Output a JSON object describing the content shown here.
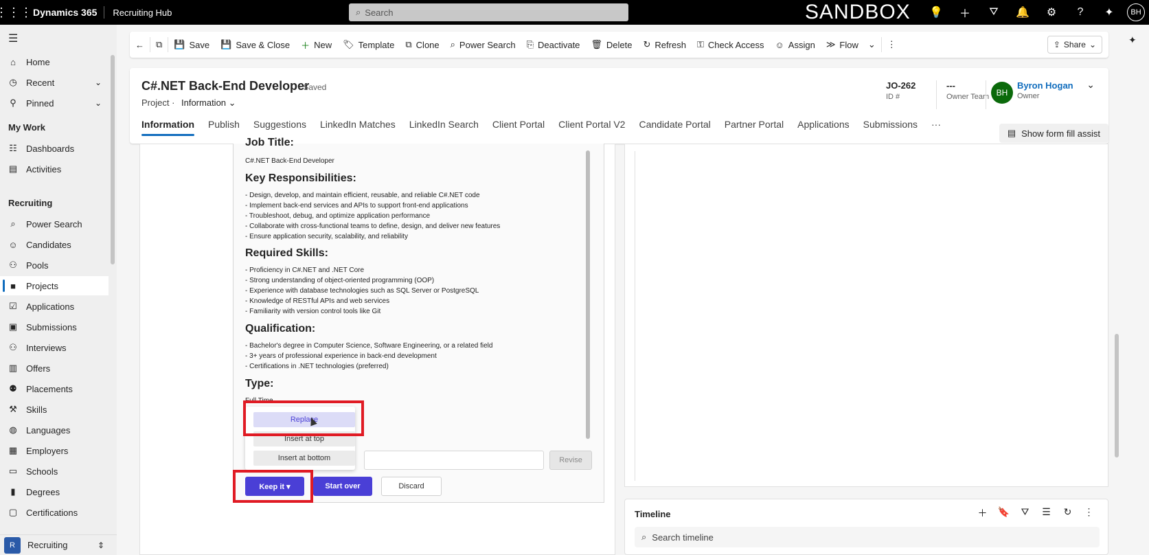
{
  "topbar": {
    "app_name": "Dynamics 365",
    "area_name": "Recruiting Hub",
    "search_placeholder": "Search",
    "sandbox_label": "SANDBOX",
    "user_initials": "BH"
  },
  "nav": {
    "items_top": [
      {
        "label": "Home",
        "icon": "home-icon"
      },
      {
        "label": "Recent",
        "icon": "clock-icon"
      },
      {
        "label": "Pinned",
        "icon": "pin-icon"
      }
    ],
    "my_work_header": "My Work",
    "my_work": [
      {
        "label": "Dashboards",
        "icon": "dashboard-icon"
      },
      {
        "label": "Activities",
        "icon": "clipboard-icon"
      }
    ],
    "recruiting_header": "Recruiting",
    "recruiting": [
      {
        "label": "Power Search"
      },
      {
        "label": "Candidates"
      },
      {
        "label": "Pools"
      },
      {
        "label": "Projects"
      },
      {
        "label": "Applications"
      },
      {
        "label": "Submissions"
      },
      {
        "label": "Interviews"
      },
      {
        "label": "Offers"
      },
      {
        "label": "Placements"
      },
      {
        "label": "Skills"
      },
      {
        "label": "Languages"
      },
      {
        "label": "Employers"
      },
      {
        "label": "Schools"
      },
      {
        "label": "Degrees"
      },
      {
        "label": "Certifications"
      }
    ],
    "area_badge": "R",
    "area_label": "Recruiting"
  },
  "commands": {
    "save": "Save",
    "save_close": "Save & Close",
    "new": "New",
    "template": "Template",
    "clone": "Clone",
    "power_search": "Power Search",
    "deactivate": "Deactivate",
    "delete": "Delete",
    "refresh": "Refresh",
    "check_access": "Check Access",
    "assign": "Assign",
    "flow": "Flow",
    "share": "Share"
  },
  "header": {
    "title": "C#.NET Back-End Developer",
    "saved": "- Saved",
    "entity": "Project",
    "form_selector": "Information",
    "id_value": "JO-262",
    "id_label": "ID #",
    "owner_team_value": "---",
    "owner_team_label": "Owner Team",
    "owner_initials": "BH",
    "owner_name": "Byron Hogan",
    "owner_label": "Owner",
    "fill_assist": "Show form fill assist"
  },
  "tabs": [
    "Information",
    "Publish",
    "Suggestions",
    "LinkedIn Matches",
    "LinkedIn Search",
    "Client Portal",
    "Client Portal V2",
    "Candidate Portal",
    "Partner Portal",
    "Applications",
    "Submissions",
    "···"
  ],
  "ai": {
    "job_title_heading": "Job Title:",
    "job_title": "C#.NET Back-End Developer",
    "resp_heading": "Key Responsibilities:",
    "responsibilities": [
      "- Design, develop, and maintain efficient, reusable, and reliable C#.NET code",
      "- Implement back-end services and APIs to support front-end applications",
      "- Troubleshoot, debug, and optimize application performance",
      "- Collaborate with cross-functional teams to define, design, and deliver new features",
      "- Ensure application security, scalability, and reliability"
    ],
    "skills_heading": "Required Skills:",
    "skills": [
      "- Proficiency in C#.NET and .NET Core",
      "- Strong understanding of object-oriented programming (OOP)",
      "- Experience with database technologies such as SQL Server or PostgreSQL",
      "- Knowledge of RESTful APIs and web services",
      "- Familiarity with version control tools like Git"
    ],
    "qual_heading": "Qualification:",
    "qualifications": [
      "- Bachelor's degree in Computer Science, Software Engineering, or a related field",
      "- 3+ years of professional experience in back-end development",
      "- Certifications in .NET technologies (preferred)"
    ],
    "type_heading": "Type:",
    "type_value": "Full Time",
    "menu": [
      "Replace",
      "Insert at top",
      "Insert at bottom"
    ],
    "revise": "Revise",
    "keep_it": "Keep it ▾",
    "start_over": "Start over",
    "discard": "Discard"
  },
  "timeline": {
    "title": "Timeline",
    "search_placeholder": "Search timeline"
  }
}
